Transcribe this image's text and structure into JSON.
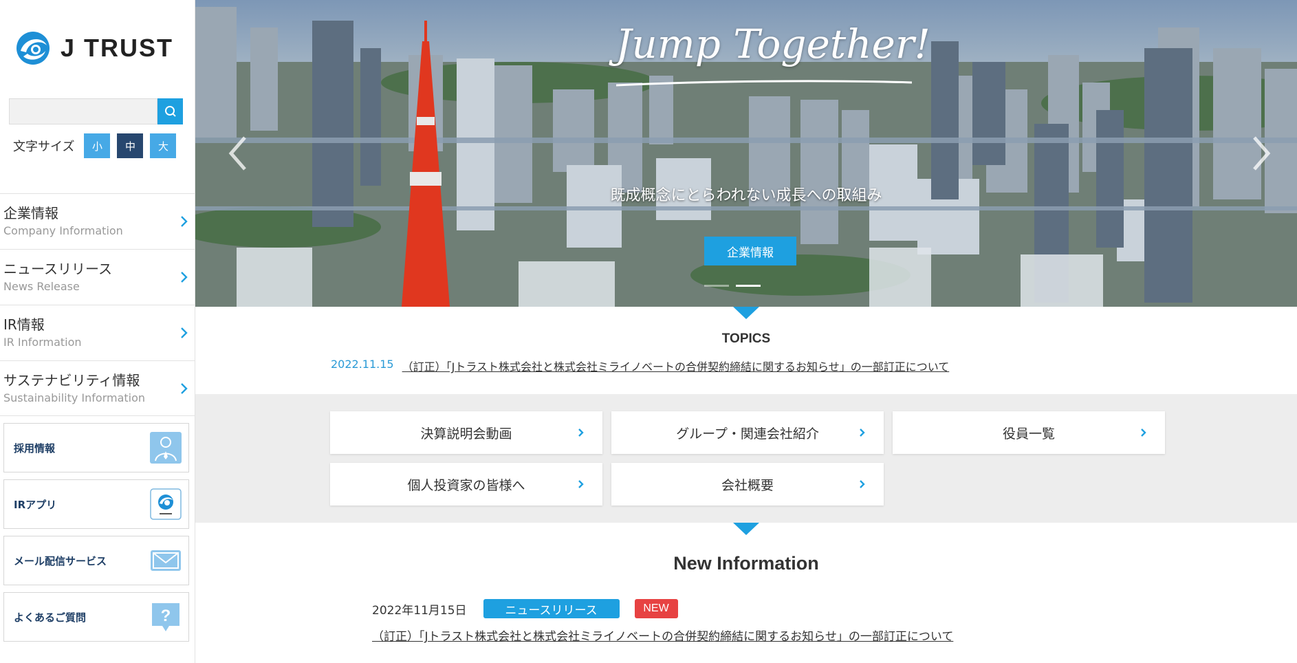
{
  "brand": {
    "name": "J TRUST",
    "accent": "#1ea0e0"
  },
  "search": {
    "placeholder": "",
    "value": ""
  },
  "font_size": {
    "label": "文字サイズ",
    "small": "小",
    "medium": "中",
    "large": "大",
    "selected": "中"
  },
  "sidebar": {
    "nav": [
      {
        "ja": "企業情報",
        "en": "Company Information"
      },
      {
        "ja": "ニュースリリース",
        "en": "News Release"
      },
      {
        "ja": "IR情報",
        "en": "IR Information"
      },
      {
        "ja": "サステナビリティ情報",
        "en": "Sustainability Information"
      }
    ],
    "services": [
      {
        "label": "採用情報",
        "icon": "person-icon"
      },
      {
        "label": "IRアプリ",
        "icon": "jtrust-app-icon"
      },
      {
        "label": "メール配信サービス",
        "icon": "mail-icon"
      },
      {
        "label": "よくあるご質問",
        "icon": "question-icon"
      }
    ]
  },
  "hero": {
    "tagline": "Jump Together!",
    "subtitle": "既成概念にとらわれない成長への取組み",
    "button": "企業情報",
    "slides": 2,
    "active_slide": 1
  },
  "topics": {
    "title": "TOPICS",
    "date": "2022.11.15",
    "text": "（訂正）「Jトラスト株式会社と株式会社ミライノベートの合併契約締結に関するお知らせ」の一部訂正について"
  },
  "quick_links": [
    "決算説明会動画",
    "グループ・関連会社紹介",
    "役員一覧",
    "個人投資家の皆様へ",
    "会社概要"
  ],
  "news": {
    "title": "New Information",
    "items": [
      {
        "date": "2022年11月15日",
        "category": "ニュースリリース",
        "badge": "NEW",
        "text": "（訂正）「Jトラスト株式会社と株式会社ミライノベートの合併契約締結に関するお知らせ」の一部訂正について"
      }
    ]
  }
}
